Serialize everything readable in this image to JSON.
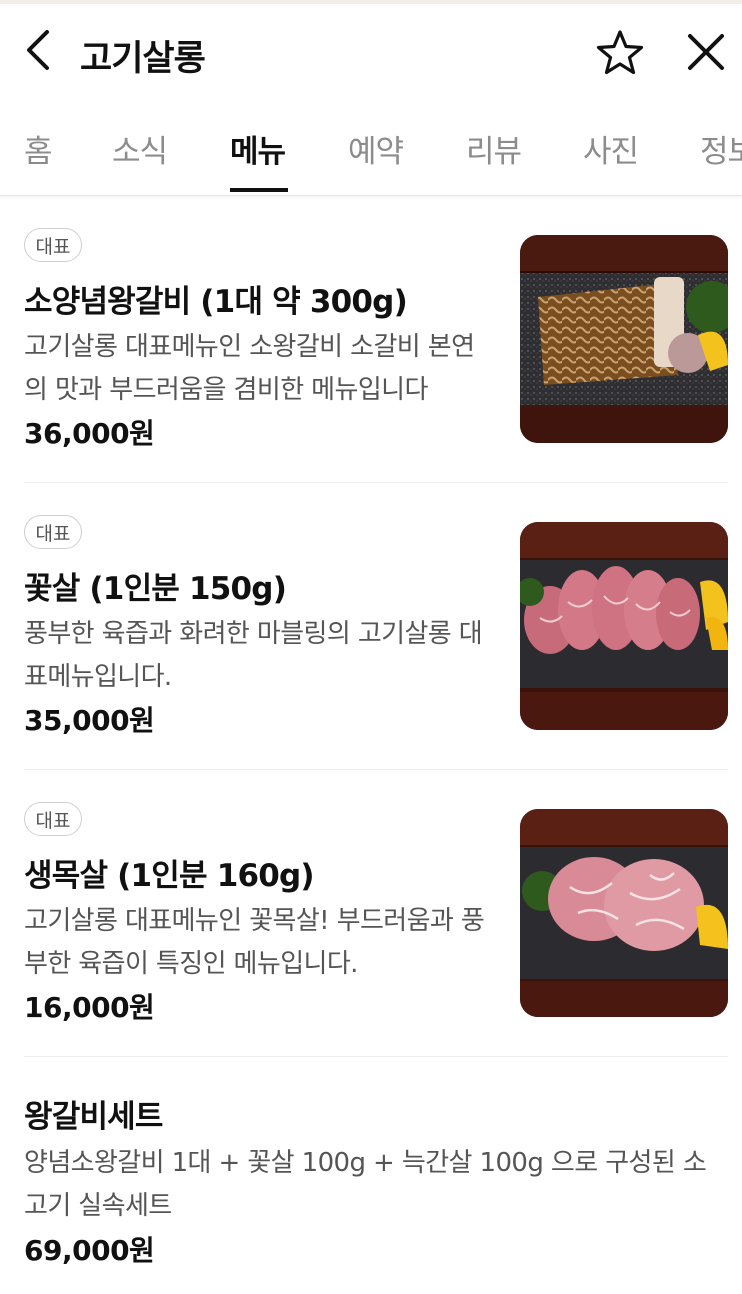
{
  "header": {
    "title": "고기살롱",
    "icons": {
      "back": "chevron-left-icon",
      "favorite": "star-outline-icon",
      "close": "close-icon"
    }
  },
  "tabs": [
    {
      "label": "홈",
      "active": false
    },
    {
      "label": "소식",
      "active": false
    },
    {
      "label": "메뉴",
      "active": true
    },
    {
      "label": "예약",
      "active": false
    },
    {
      "label": "리뷰",
      "active": false
    },
    {
      "label": "사진",
      "active": false
    },
    {
      "label": "정보",
      "active": false
    }
  ],
  "menu": [
    {
      "badge": "대표",
      "name": "소양념왕갈비 (1대 약 300g)",
      "description": "고기살롱 대표메뉴인 소왕갈비 소갈비 본연의 맛과 부드러움을 겸비한 메뉴입니다",
      "price": "36,000원"
    },
    {
      "badge": "대표",
      "name": "꽃살 (1인분 150g)",
      "description": "풍부한 육즙과 화려한 마블링의 고기살롱 대표메뉴입니다.",
      "price": "35,000원"
    },
    {
      "badge": "대표",
      "name": "생목살 (1인분 160g)",
      "description": "고기살롱 대표메뉴인 꽃목살! 부드러움과 풍부한 육즙이 특징인 메뉴입니다.",
      "price": "16,000원"
    },
    {
      "name": "왕갈비세트",
      "description": "양념소왕갈비 1대 + 꽃살 100g + 늑간살 100g 으로 구성된 소고기 실속세트",
      "price": "69,000원"
    }
  ],
  "colors": {
    "accent": "#111111",
    "muted_tab": "#8c8c8c",
    "description": "#555555",
    "divider": "#efefef"
  }
}
